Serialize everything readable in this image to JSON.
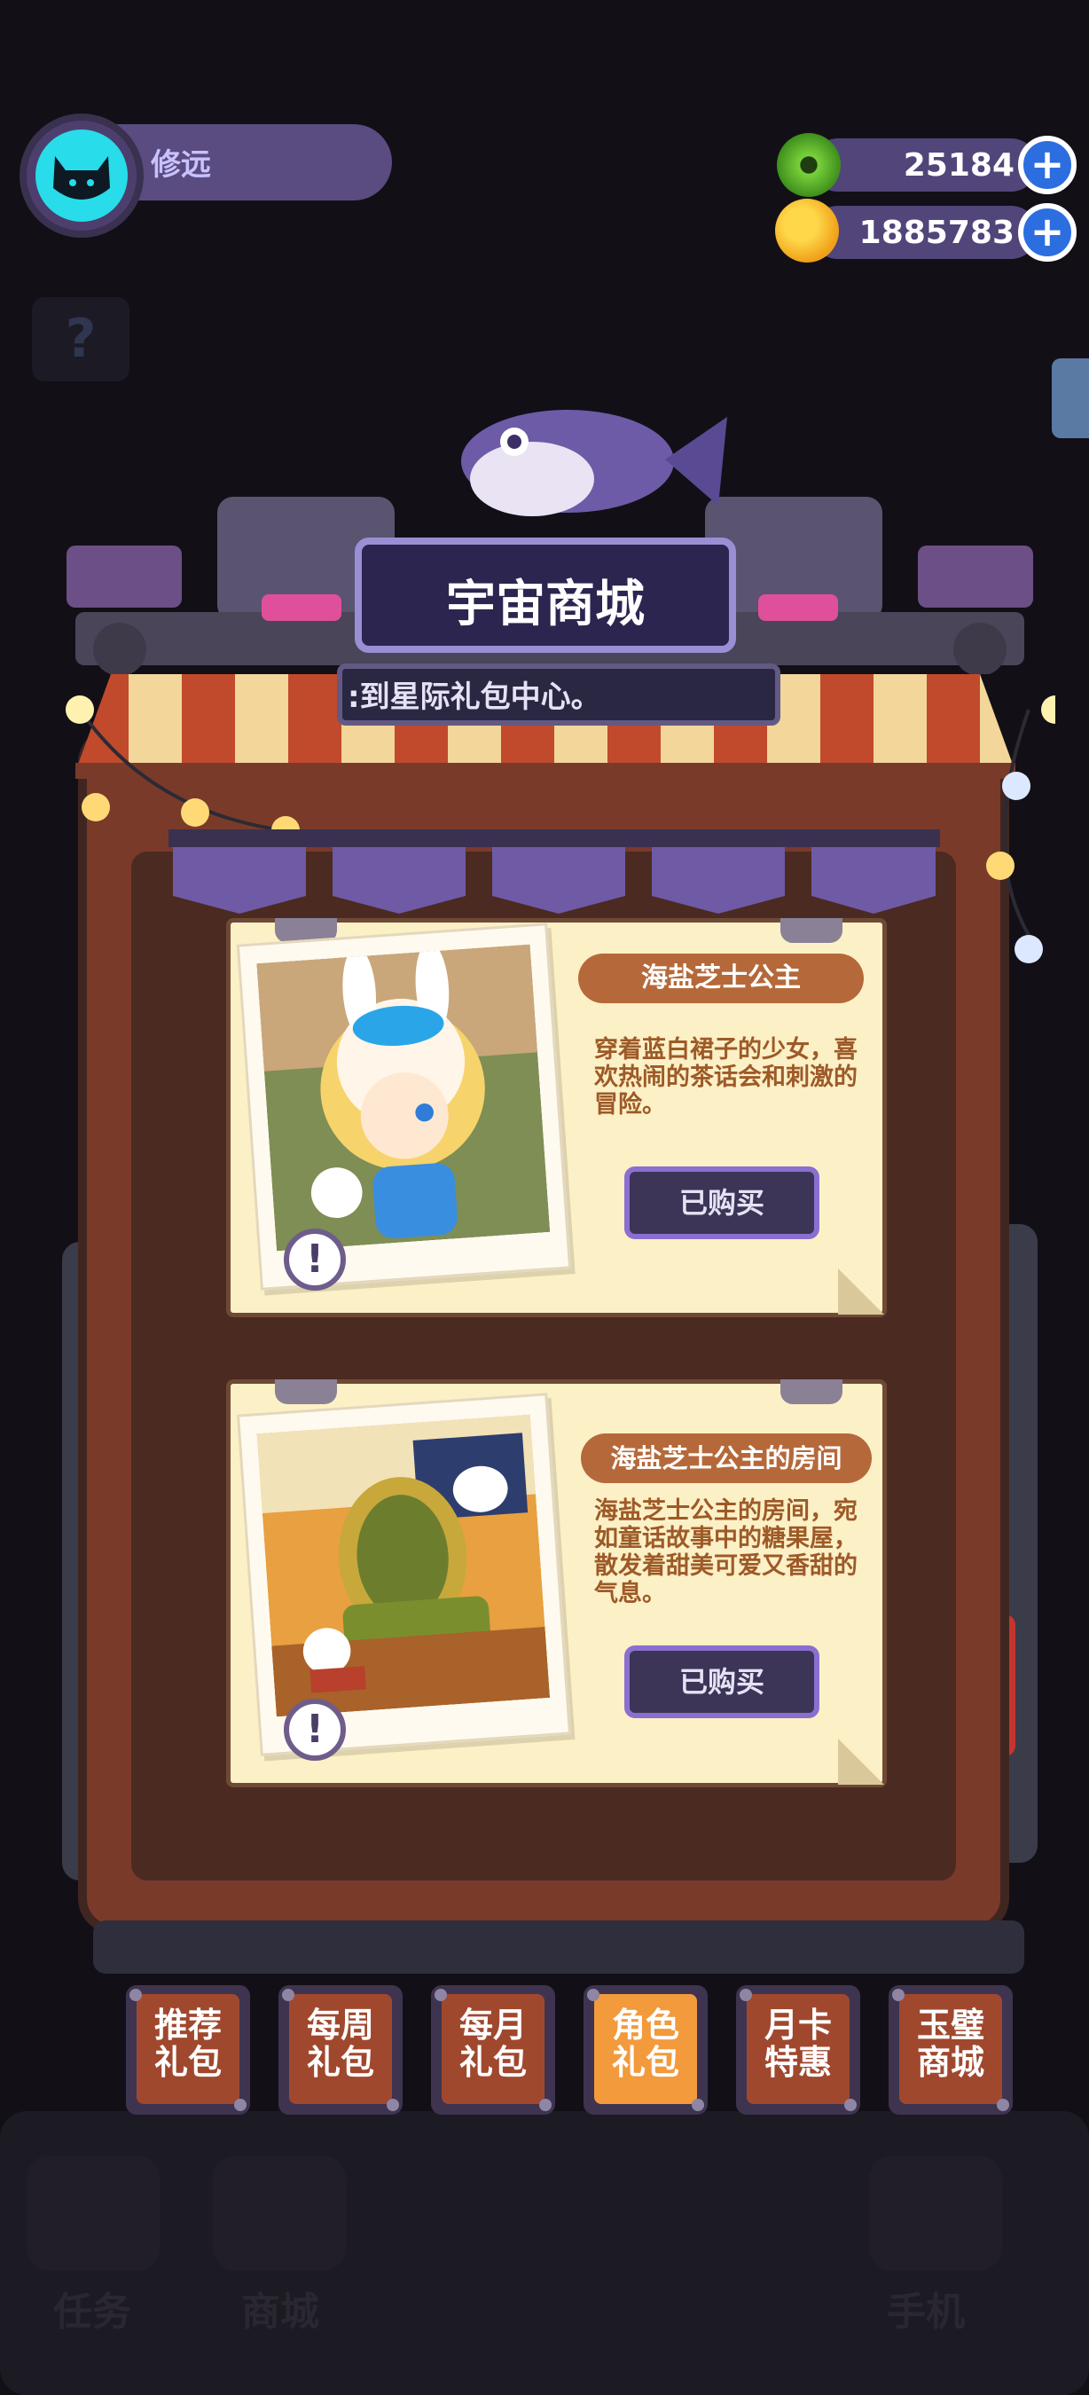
{
  "user": {
    "name": "修远"
  },
  "currency": {
    "gems": {
      "value": "25184",
      "icon": "donut-gem-icon"
    },
    "coins": {
      "value": "1885783",
      "icon": "planet-coin-icon"
    }
  },
  "shop": {
    "title": "宇宙商城",
    "subtitle": ":到星际礼包中心。"
  },
  "cards": [
    {
      "name": "海盐芝士公主",
      "description": "穿着蓝白裙子的少女，喜欢热闹的茶话会和刺激的冒险。",
      "button": "已购买"
    },
    {
      "name": "海盐芝士公主的房间",
      "description": "海盐芝士公主的房间，宛如童话故事中的糖果屋，散发着甜美可爱又香甜的气息。",
      "button": "已购买"
    }
  ],
  "tabs": [
    {
      "line1": "推荐",
      "line2": "礼包",
      "active": false
    },
    {
      "line1": "每周",
      "line2": "礼包",
      "active": false
    },
    {
      "line1": "每月",
      "line2": "礼包",
      "active": false
    },
    {
      "line1": "角色",
      "line2": "礼包",
      "active": true
    },
    {
      "line1": "月卡",
      "line2": "特惠",
      "active": false
    },
    {
      "line1": "玉璧",
      "line2": "商城",
      "active": false
    }
  ],
  "bottom_nav": [
    "任务",
    "商城",
    "手机"
  ],
  "help_icon": "?",
  "info_icon": "!",
  "plus_icon": "+",
  "colors": {
    "accent_active_tab": "#f29a3c",
    "tab_face": "#a0482e",
    "card_bg": "#fcf0c6",
    "desc_text": "#9d5a28",
    "avatar": "#28dcea"
  }
}
